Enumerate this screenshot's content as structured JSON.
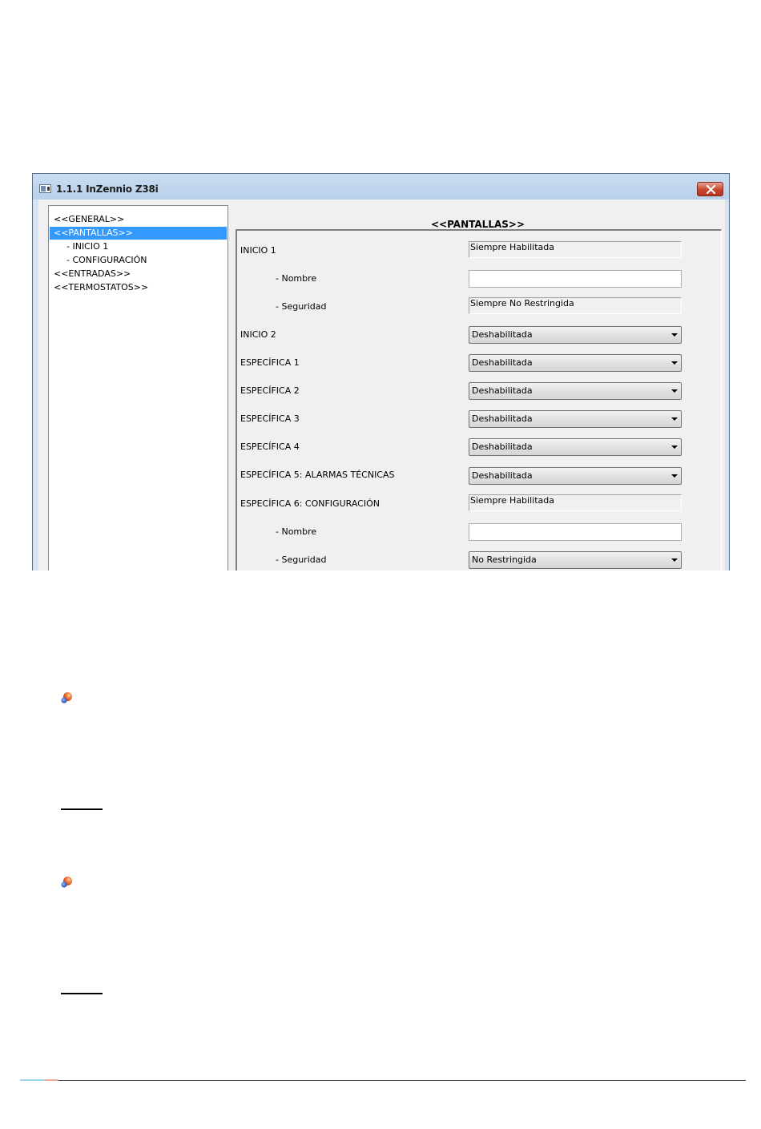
{
  "window": {
    "title": "1.1.1 InZennio Z38i"
  },
  "tree": {
    "items": [
      {
        "label": "<<GENERAL>>"
      },
      {
        "label": "<<PANTALLAS>>"
      },
      {
        "label": "- INICIO 1"
      },
      {
        "label": "- CONFIGURACIÓN"
      },
      {
        "label": "<<ENTRADAS>>"
      },
      {
        "label": "<<TERMOSTATOS>>"
      }
    ],
    "selected_index": 1
  },
  "panel": {
    "title": "<<PANTALLAS>>",
    "rows": [
      {
        "label": "INICIO 1",
        "value": "Siempre Habilitada"
      },
      {
        "label": "- Nombre",
        "value": ""
      },
      {
        "label": "- Seguridad",
        "value": "Siempre No Restringida"
      },
      {
        "label": "INICIO 2",
        "value": "Deshabilitada"
      },
      {
        "label": "ESPECÍFICA 1",
        "value": "Deshabilitada"
      },
      {
        "label": "ESPECÍFICA 2",
        "value": "Deshabilitada"
      },
      {
        "label": "ESPECÍFICA 3",
        "value": "Deshabilitada"
      },
      {
        "label": "ESPECÍFICA 4",
        "value": "Deshabilitada"
      },
      {
        "label": "ESPECÍFICA 5: ALARMAS TÉCNICAS",
        "value": "Deshabilitada"
      },
      {
        "label": "ESPECÍFICA 6: CONFIGURACIÓN",
        "value": "Siempre Habilitada"
      },
      {
        "label": "- Nombre",
        "value": ""
      },
      {
        "label": "- Seguridad",
        "value": "No Restringida"
      }
    ]
  },
  "icons": {
    "bullet": "bullet-sphere-icon",
    "close": "close-icon",
    "window": "window-icon"
  },
  "colors": {
    "selection": "#3399ff",
    "close_button": "#c9442e",
    "bullet_orange": "#e8542a",
    "bullet_blue": "#2a4fb8"
  }
}
